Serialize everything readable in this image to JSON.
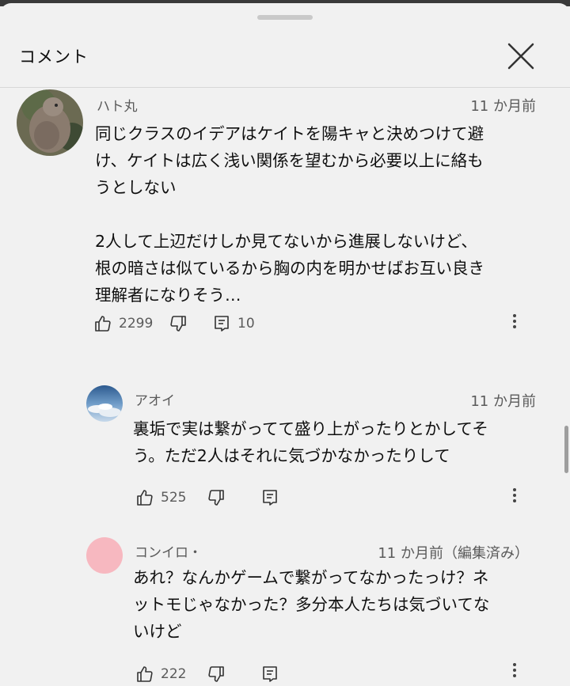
{
  "header": {
    "title": "コメント"
  },
  "comments": [
    {
      "author": "ハト丸",
      "time": "11 か月前",
      "text": "同じクラスのイデアはケイトを陽キャと決めつけて避\nけ、ケイトは広く浅い関係を望むから必要以上に絡も\nうとしない\n\n2人して上辺だけしか見てないから進展しないけど、\n根の暗さは似ているから胸の内を明かせばお互い良き\n理解者になりそう…",
      "likes": "2299",
      "replies": "10"
    },
    {
      "author": "アオイ",
      "time": "11 か月前",
      "text": "裏垢で実は繋がってて盛り上がったりとかしてそ\nう。ただ2人はそれに気づかなかったりして",
      "likes": "525"
    },
    {
      "author": "コンイロ・",
      "time": "11 か月前（編集済み）",
      "text": "あれ？なんかゲームで繋がってなかったっけ？ネ\nットモじゃなかった？多分本人たちは気づいてな\nいけど",
      "likes": "222"
    }
  ],
  "colors": {
    "background": "#f1f1f1",
    "pink_avatar": "#f7b8c0",
    "secondary_text": "#5a5a5a"
  }
}
